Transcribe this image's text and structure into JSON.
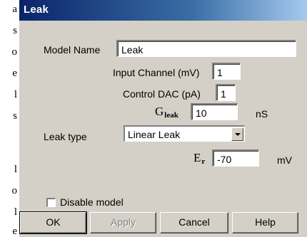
{
  "background_text": [
    "a",
    "s",
    "o",
    "e",
    "l",
    "s",
    "",
    "l",
    "o",
    "l",
    "e"
  ],
  "window": {
    "title": "Leak"
  },
  "form": {
    "model_name_label": "Model Name",
    "model_name_value": "Leak",
    "input_channel_label": "Input Channel (mV)",
    "input_channel_value": "1",
    "control_dac_label": "Control DAC (pA)",
    "control_dac_value": "1",
    "gleak_symbol": "G",
    "gleak_subscript": "leak",
    "gleak_value": "10",
    "gleak_unit": "nS",
    "leak_type_label": "Leak type",
    "leak_type_selected": "Linear Leak",
    "er_symbol": "E",
    "er_subscript": "r",
    "er_value": "-70",
    "er_unit": "mV",
    "disable_model_label": "Disable model",
    "disable_model_checked": false
  },
  "buttons": {
    "ok": "OK",
    "apply": "Apply",
    "cancel": "Cancel",
    "help": "Help"
  }
}
